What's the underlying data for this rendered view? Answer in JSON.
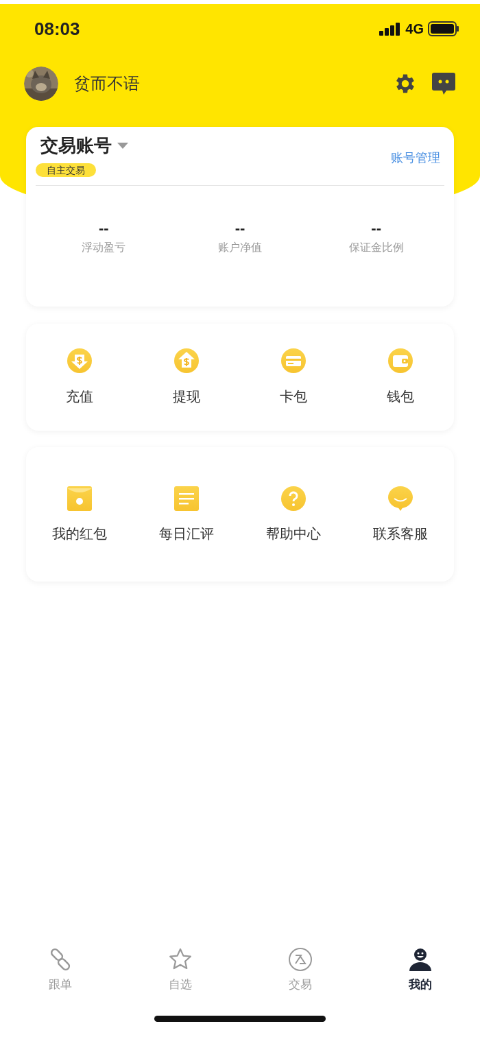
{
  "status_bar": {
    "time": "08:03",
    "network": "4G"
  },
  "profile": {
    "username": "贫而不语"
  },
  "account_card": {
    "title": "交易账号",
    "tag": "自主交易",
    "manage_link": "账号管理",
    "stats": [
      {
        "value": "--",
        "label": "浮动盈亏"
      },
      {
        "value": "--",
        "label": "账户净值"
      },
      {
        "value": "--",
        "label": "保证金比例"
      }
    ]
  },
  "wallet_actions": [
    {
      "label": "充值"
    },
    {
      "label": "提现"
    },
    {
      "label": "卡包"
    },
    {
      "label": "钱包"
    }
  ],
  "services": [
    {
      "label": "我的红包"
    },
    {
      "label": "每日汇评"
    },
    {
      "label": "帮助中心"
    },
    {
      "label": "联系客服"
    }
  ],
  "tab_bar": [
    {
      "label": "跟单",
      "selected": false
    },
    {
      "label": "自选",
      "selected": false
    },
    {
      "label": "交易",
      "selected": false
    },
    {
      "label": "我的",
      "selected": true
    }
  ]
}
